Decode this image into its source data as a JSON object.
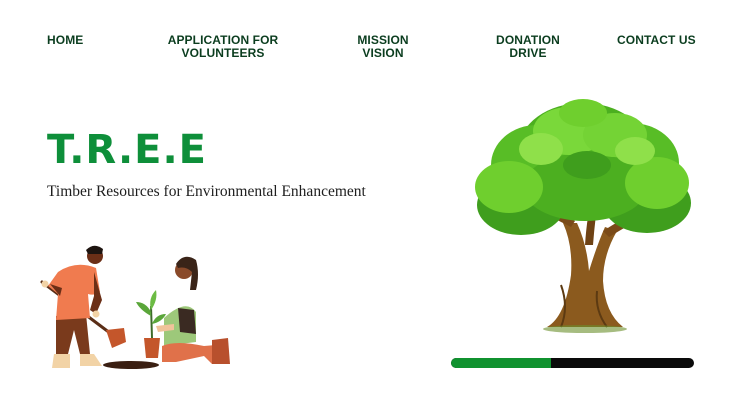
{
  "nav": {
    "home": [
      "HOME"
    ],
    "volunteers": [
      "APPLICATION FOR",
      "VOLUNTEERS"
    ],
    "mission": [
      "MISSION",
      "VISION"
    ],
    "donation": [
      "DONATION",
      "DRIVE"
    ],
    "contact": [
      "CONTACT US"
    ]
  },
  "hero": {
    "title": "T.R.E.E",
    "subtitle": "Timber Resources for Environmental Enhancement"
  },
  "progress": {
    "value": 0.41
  },
  "colors": {
    "nav_text": "#0b3d1f",
    "title": "#0e8f3a",
    "progress_fill": "#10922f",
    "progress_track": "#0a0a0a"
  }
}
